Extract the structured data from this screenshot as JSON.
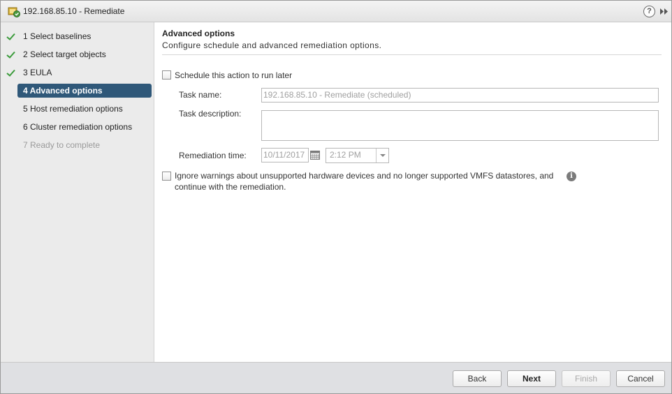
{
  "window": {
    "title": "192.168.85.10 - Remediate",
    "help_label": "?"
  },
  "sidebar": {
    "steps": [
      {
        "label": "1  Select baselines",
        "state": "done"
      },
      {
        "label": "2  Select target objects",
        "state": "done"
      },
      {
        "label": "3  EULA",
        "state": "done"
      },
      {
        "label": "4  Advanced options",
        "state": "active"
      },
      {
        "label": "5  Host remediation options",
        "state": "pending"
      },
      {
        "label": "6  Cluster remediation options",
        "state": "pending"
      },
      {
        "label": "7  Ready to complete",
        "state": "disabled"
      }
    ]
  },
  "content": {
    "title": "Advanced options",
    "description": "Configure schedule and advanced remediation options.",
    "schedule_label": "Schedule this action to run later",
    "task_name_label": "Task name:",
    "task_name_value": "192.168.85.10 - Remediate (scheduled)",
    "task_description_label": "Task description:",
    "task_description_value": "",
    "remediation_time_label": "Remediation time:",
    "date_value": "10/11/2017",
    "time_value": "2:12 PM",
    "ignore_warnings_label_line1": "Ignore warnings about unsupported hardware devices and no longer supported VMFS datastores, and",
    "ignore_warnings_label_line2": "continue with the remediation.",
    "info_symbol": "i"
  },
  "footer": {
    "back_label": "Back",
    "next_label": "Next",
    "finish_label": "Finish",
    "cancel_label": "Cancel"
  },
  "colors": {
    "active_step": "#2f5879",
    "check_green": "#3a9b3a",
    "footer_bg": "#dfe0e3",
    "sidebar_bg": "#ebebeb"
  }
}
